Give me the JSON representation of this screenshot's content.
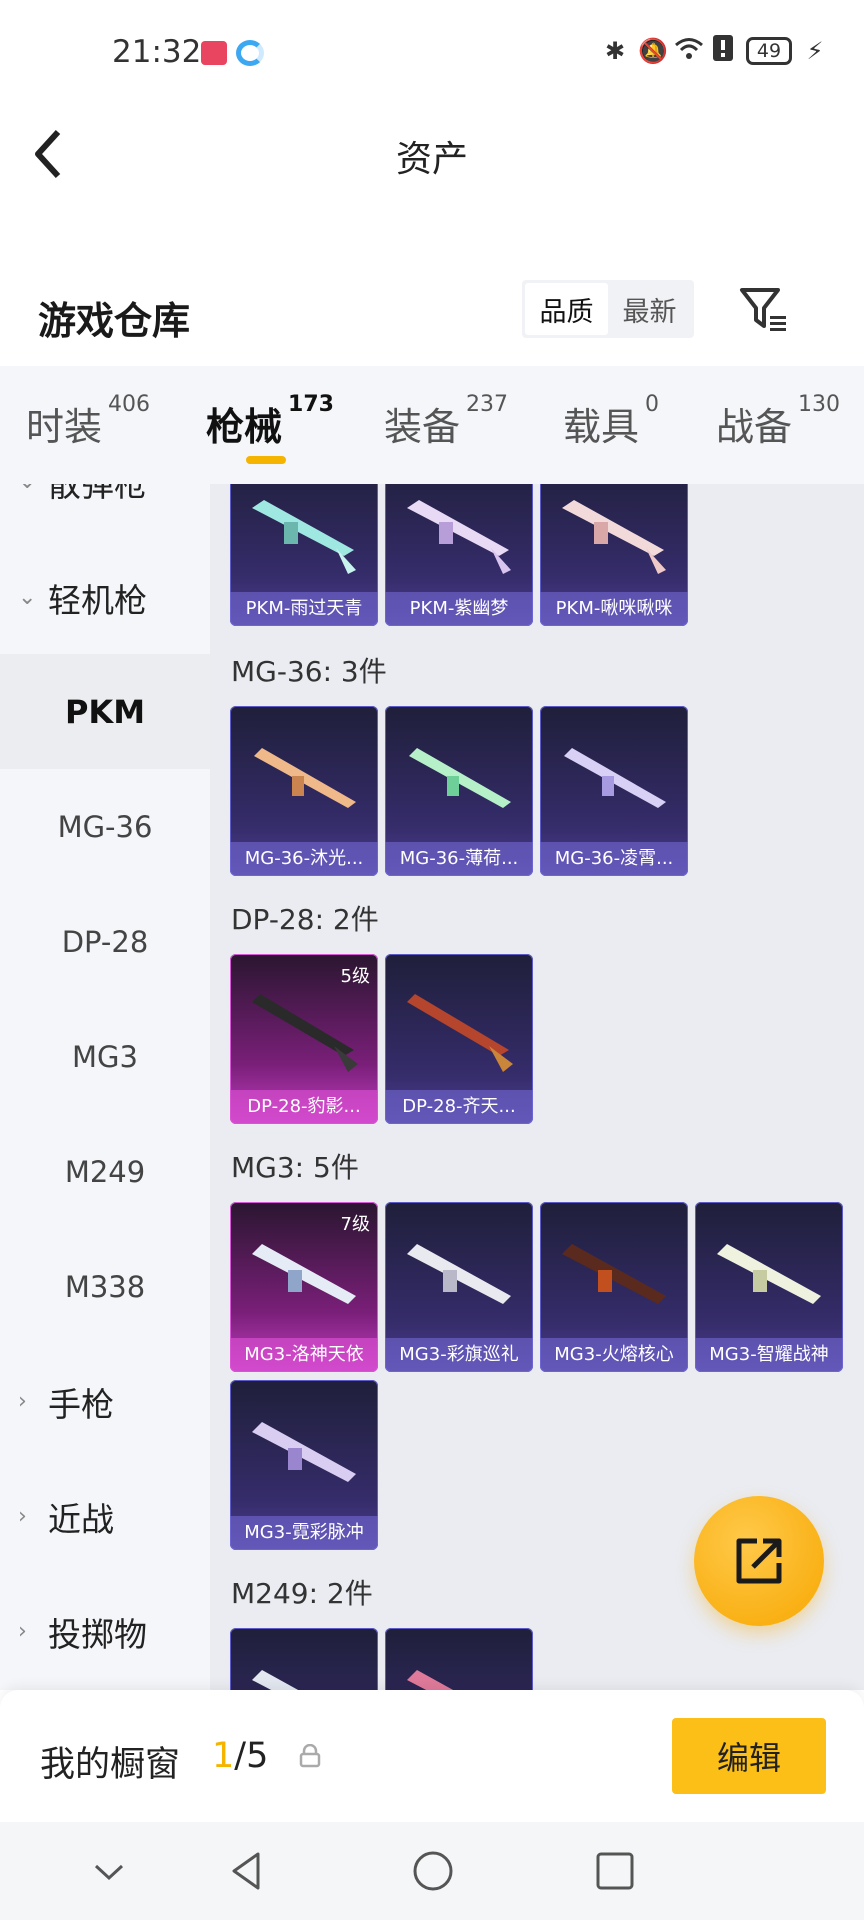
{
  "status": {
    "time": "21:32",
    "battery": "49"
  },
  "header": {
    "title": "资产"
  },
  "section": {
    "title": "游戏仓库",
    "sort_quality": "品质",
    "sort_newest": "最新"
  },
  "tabs": [
    {
      "label": "时装",
      "count": "406"
    },
    {
      "label": "枪械",
      "count": "173"
    },
    {
      "label": "装备",
      "count": "237"
    },
    {
      "label": "载具",
      "count": "0"
    },
    {
      "label": "战备",
      "count": "130"
    }
  ],
  "sidebar": {
    "top_partial": "散弹枪",
    "group_lmg": "轻机枪",
    "subs": [
      "PKM",
      "MG-36",
      "DP-28",
      "MG3",
      "M249",
      "M338"
    ],
    "group_pistol": "手枪",
    "group_melee": "近战",
    "group_throw": "投掷物"
  },
  "groups": {
    "pkm": {
      "items": [
        "PKM-雨过天青",
        "PKM-紫幽梦",
        "PKM-啾咪啾咪"
      ]
    },
    "mg36": {
      "label": "MG-36: 3件",
      "items": [
        "MG-36-沐光...",
        "MG-36-薄荷...",
        "MG-36-凌霄..."
      ]
    },
    "dp28": {
      "label": "DP-28: 2件",
      "items": [
        "DP-28-豹影...",
        "DP-28-齐天..."
      ],
      "level0": "5级"
    },
    "mg3": {
      "label": "MG3: 5件",
      "items": [
        "MG3-洛神天依",
        "MG3-彩旗巡礼",
        "MG3-火熔核心",
        "MG3-智耀战神",
        "MG3-霓彩脉冲"
      ],
      "level0": "7级"
    },
    "m249": {
      "label": "M249: 2件"
    }
  },
  "shelf": {
    "label": "我的橱窗",
    "current": "1",
    "total": "/5",
    "edit": "编辑"
  },
  "colors": {
    "accent": "#fbbf17",
    "card_blue": "#352c6a",
    "card_pink": "#c23ec4"
  }
}
